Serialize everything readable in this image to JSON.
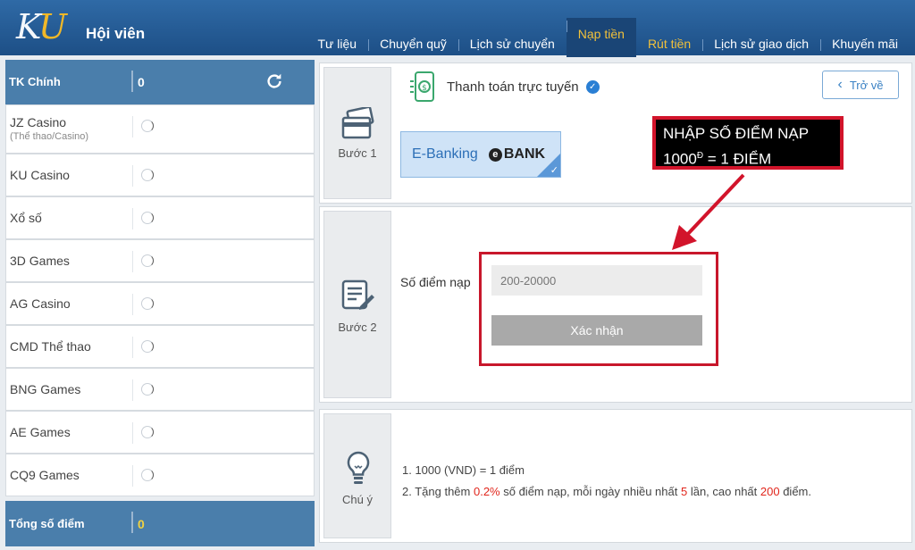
{
  "header": {
    "logo_k": "K",
    "logo_u": "U",
    "title": "Hội viên",
    "nav": [
      {
        "label": "Tư liệu"
      },
      {
        "label": "Chuyển quỹ"
      },
      {
        "label": "Lịch sử chuyển"
      },
      {
        "label": "Nạp tiền",
        "active": true
      },
      {
        "label": "Rút tiền",
        "highlight": true
      },
      {
        "label": "Lịch sử giao dịch"
      },
      {
        "label": "Khuyến mãi"
      }
    ]
  },
  "sidebar": {
    "main_account": {
      "label": "TK Chính",
      "value": "0"
    },
    "accounts": [
      {
        "label": "JZ Casino",
        "sub": "(Thể thao/Casino)"
      },
      {
        "label": "KU Casino",
        "sub": ""
      },
      {
        "label": "Xổ số",
        "sub": ""
      },
      {
        "label": "3D Games",
        "sub": ""
      },
      {
        "label": "AG Casino",
        "sub": ""
      },
      {
        "label": "CMD Thể thao",
        "sub": ""
      },
      {
        "label": "BNG Games",
        "sub": ""
      },
      {
        "label": "AE Games",
        "sub": ""
      },
      {
        "label": "CQ9 Games",
        "sub": ""
      }
    ],
    "total": {
      "label": "Tổng số điểm",
      "value": "0"
    }
  },
  "step1": {
    "label": "Bước 1",
    "payment_title": "Thanh toán trực tuyến",
    "back_label": "Trở về",
    "method_label": "E-Banking",
    "bank_letter": "e",
    "bank_text": "BANK"
  },
  "annotation": {
    "line1": "NHẬP SỐ ĐIỂM NẠP",
    "line2_a": "1000",
    "line2_sup": "Đ",
    "line2_b": " = 1 ĐIỂM"
  },
  "step2": {
    "label": "Bước 2",
    "amount_label": "Số điểm nạp",
    "amount_placeholder": "200-20000",
    "confirm_label": "Xác nhận"
  },
  "notes": {
    "label": "Chú ý",
    "line1": "1.  1000 (VND) = 1 điểm",
    "line2_a": "2.  Tặng thêm ",
    "line2_pct": "0.2%",
    "line2_b": " số điểm nạp, mỗi ngày nhiều nhất ",
    "line2_times": "5",
    "line2_c": " lần, cao nhất ",
    "line2_max": "200",
    "line2_d": " điểm."
  },
  "colors": {
    "header": "#2f6aa6",
    "accent_gold": "#f2c13a",
    "annotation_red": "#c8172b",
    "sidebar_head": "#4a7eab"
  }
}
